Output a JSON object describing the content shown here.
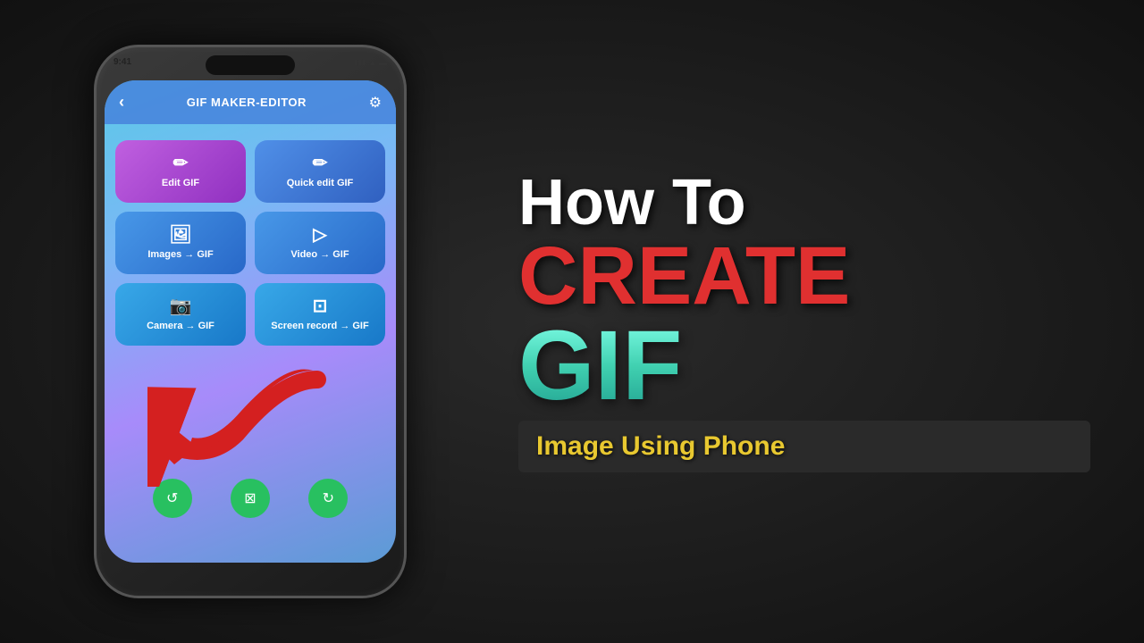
{
  "page": {
    "background": "#1a1a1a"
  },
  "phone": {
    "status_time": "9:41",
    "app_title": "GIF MAKER-EDITOR",
    "back_icon": "‹",
    "settings_icon": "⚙"
  },
  "buttons": [
    {
      "id": "edit-gif",
      "label": "Edit GIF",
      "icon": "✏"
    },
    {
      "id": "quick-edit-gif",
      "label": "Quick edit GIF",
      "icon": "✏"
    },
    {
      "id": "images-gif",
      "label": "Images → GIF",
      "icon": "🖼"
    },
    {
      "id": "video-gif",
      "label": "Video → GIF",
      "icon": "▷"
    },
    {
      "id": "camera-gif",
      "label": "Camera → GIF",
      "icon": "📷"
    },
    {
      "id": "screen-record-gif",
      "label": "Screen record → GIF",
      "icon": "⊡"
    }
  ],
  "nav_buttons": [
    {
      "id": "nav-history",
      "icon": "↺"
    },
    {
      "id": "nav-crop",
      "icon": "⊠"
    },
    {
      "id": "nav-image",
      "icon": "↻"
    }
  ],
  "text_section": {
    "line1": "How To",
    "line2": "CREATE",
    "line3": "GIF",
    "subtitle": "Image Using Phone"
  }
}
